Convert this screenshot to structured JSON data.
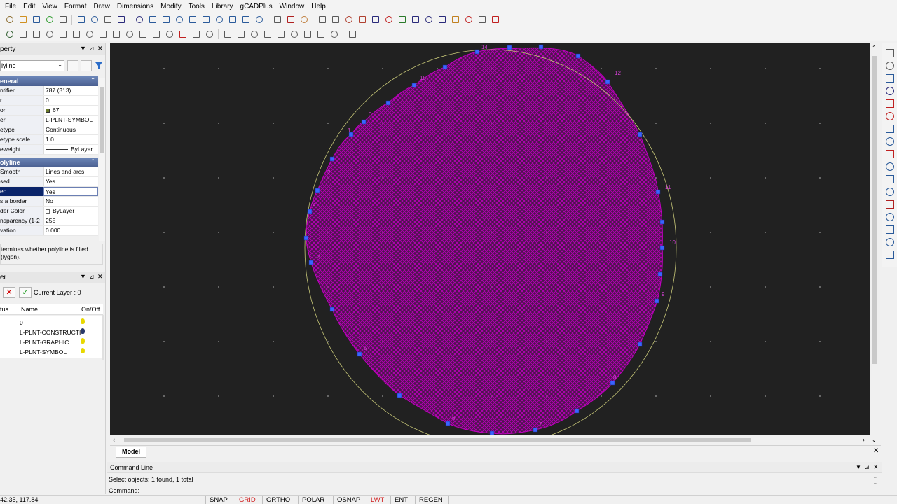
{
  "menu": [
    "File",
    "Edit",
    "View",
    "Format",
    "Draw",
    "Dimensions",
    "Modify",
    "Tools",
    "Library",
    "gCADPlus",
    "Window",
    "Help"
  ],
  "property_panel": {
    "title": "perty",
    "selector": "lyline",
    "categories": {
      "general": "eneral",
      "polyline": "olyline"
    },
    "general_rows": [
      {
        "key": "ntifier",
        "value": "787 (313)"
      },
      {
        "key": "r",
        "value": "0"
      },
      {
        "key": "or",
        "value": "67"
      },
      {
        "key": "er",
        "value": "L-PLNT-SYMBOL"
      },
      {
        "key": "etype",
        "value": "Continuous"
      },
      {
        "key": "etype scale",
        "value": "1.0"
      },
      {
        "key": "eweight",
        "value": "ByLayer"
      }
    ],
    "polyline_rows": [
      {
        "key": "Smooth",
        "value": "Lines and arcs"
      },
      {
        "key": "sed",
        "value": "Yes"
      },
      {
        "key": "ed",
        "value": "Yes"
      },
      {
        "key": "s a border",
        "value": "No"
      },
      {
        "key": "der Color",
        "value": "ByLayer"
      },
      {
        "key": "nsparency (1-2",
        "value": "255"
      },
      {
        "key": "vation",
        "value": "0.000"
      }
    ],
    "description": "termines whether polyline is filled (lygon)."
  },
  "layer_panel": {
    "title": "er",
    "current_layer": "Current Layer : 0",
    "columns": {
      "status": "tus",
      "name": "Name",
      "onoff": "On/Off"
    },
    "layers": [
      "0",
      "L-PLNT-CONSTRUCTI",
      "L-PLNT-GRAPHIC",
      "L-PLNT-SYMBOL"
    ]
  },
  "canvas": {
    "vertex_labels": [
      "14",
      "12",
      "11",
      "10",
      "9",
      "8",
      "7",
      "6",
      "5",
      "4",
      "3",
      "2",
      "1",
      "0",
      "15"
    ],
    "model_tab": "Model"
  },
  "command": {
    "title": "Command Line",
    "history": "Select objects: 1 found, 1 total",
    "prompt": "Command:"
  },
  "status": {
    "coords": "42.35, 117.84",
    "buttons": [
      "SNAP",
      "GRID",
      "ORTHO",
      "POLAR",
      "OSNAP",
      "LWT",
      "ENT",
      "REGEN"
    ]
  },
  "colors": {
    "canvas_bg": "#212121",
    "hatch": "#c800c8",
    "vertex": "#3a64ff",
    "circle": "#c8c878",
    "active_status": "#d02020",
    "highlight": "#0a246a"
  }
}
